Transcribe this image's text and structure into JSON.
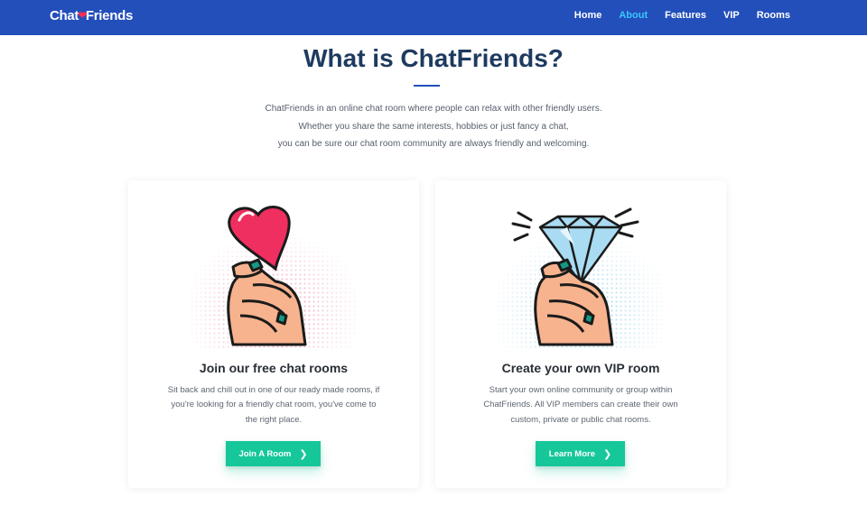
{
  "nav": {
    "logo_part1": "Chat",
    "logo_part2": "Friends",
    "logo_icon": "heart-icon",
    "links": [
      "Home",
      "About",
      "Features",
      "VIP",
      "Rooms"
    ],
    "active": "About",
    "bg_color": "#234fbb",
    "active_color": "#3ac7ff"
  },
  "main": {
    "title": "What is ChatFriends?",
    "intro": [
      "ChatFriends in an online chat room where people can relax with other friendly users.",
      "Whether you share the same interests, hobbies or just fancy a chat,",
      "you can be sure our chat room community are always friendly and welcoming."
    ]
  },
  "cards": [
    {
      "illustration": "hand-holding-heart",
      "title": "Join our free chat rooms",
      "text": [
        "Sit back and chill out in one of our ready made rooms, if",
        "you're looking for a friendly chat room, you've come to",
        "the right place."
      ],
      "button": "Join A Room",
      "button_icon": "chevron-right-icon"
    },
    {
      "illustration": "hand-holding-diamond",
      "title": "Create your own VIP room",
      "text": [
        "Start your own online community or group within",
        "ChatFriends. All VIP members can create their own",
        "custom, private or public chat rooms."
      ],
      "button": "Learn More",
      "button_icon": "chevron-right-icon"
    }
  ],
  "colors": {
    "accent": "#16c79a",
    "heading": "#1e3a5f",
    "heart": "#ef2f60",
    "diamond": "#a9dcf3"
  }
}
